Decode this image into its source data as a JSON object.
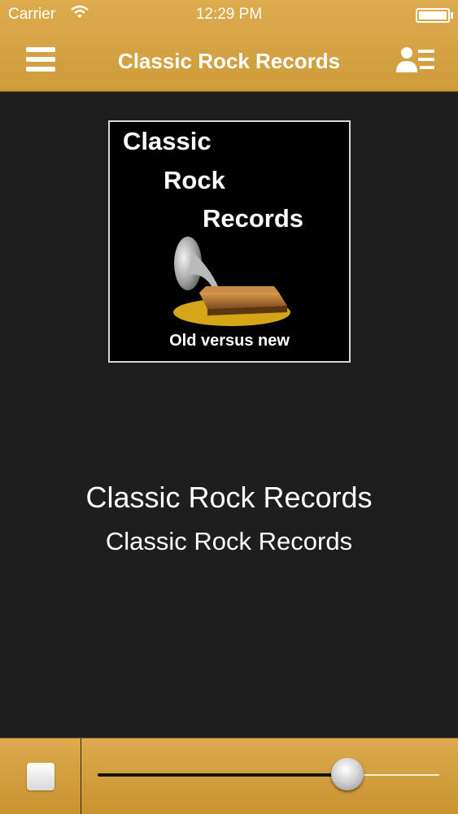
{
  "status_bar": {
    "carrier": "Carrier",
    "time": "12:29 PM"
  },
  "nav": {
    "title": "Classic Rock Records",
    "menu_icon": "hamburger-menu-icon",
    "contact_icon": "contact-list-icon"
  },
  "cover": {
    "lines": [
      "Classic",
      "Rock",
      "Records"
    ],
    "tagline": "Old versus new"
  },
  "now_playing": {
    "title": "Classic Rock Records",
    "subtitle": "Classic Rock Records"
  },
  "player": {
    "stop_icon": "stop-icon",
    "volume_level": 0.73
  },
  "colors": {
    "bar": "#d4a344",
    "background": "#1e1e1e",
    "text": "#ffffff"
  }
}
